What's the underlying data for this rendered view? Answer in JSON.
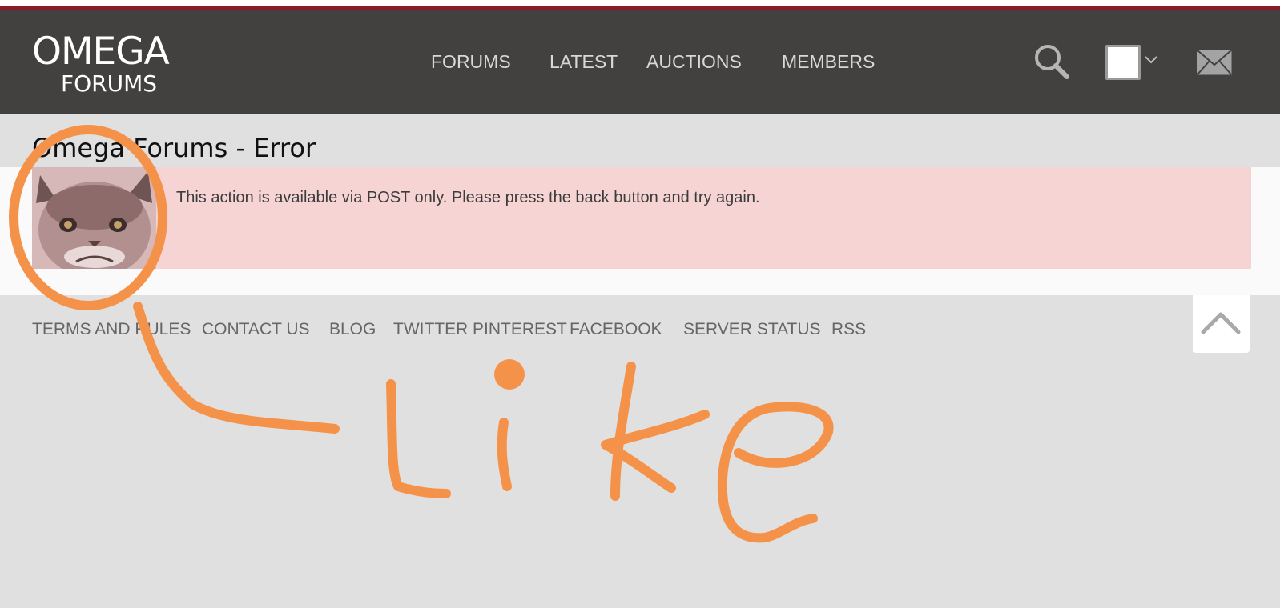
{
  "logo": {
    "line1": "OMEGA",
    "line2": "FORUMS"
  },
  "nav": {
    "items": [
      {
        "label": "FORUMS"
      },
      {
        "label": "LATEST"
      },
      {
        "label": "AUCTIONS"
      },
      {
        "label": "MEMBERS"
      }
    ]
  },
  "header": {
    "icons": {
      "search": "search-icon",
      "account": "avatar-dropdown",
      "mail": "envelope-icon"
    }
  },
  "page": {
    "title": "Omega Forums - Error",
    "error_message": "This action is available via POST only. Please press the back button and try again."
  },
  "footer": {
    "links": [
      {
        "label": "TERMS AND RULES"
      },
      {
        "label": "CONTACT US"
      },
      {
        "label": "BLOG"
      },
      {
        "label": "TWITTER"
      },
      {
        "label": "PINTEREST"
      },
      {
        "label": "FACEBOOK"
      },
      {
        "label": "SERVER STATUS"
      },
      {
        "label": "RSS"
      }
    ]
  },
  "annotation": {
    "text": "Like",
    "color": "#f5924a"
  },
  "colors": {
    "header_bg": "#434140",
    "accent_red": "#8a1c2a",
    "error_bg": "#f6d4d4",
    "page_bg": "#e0e0e0"
  }
}
